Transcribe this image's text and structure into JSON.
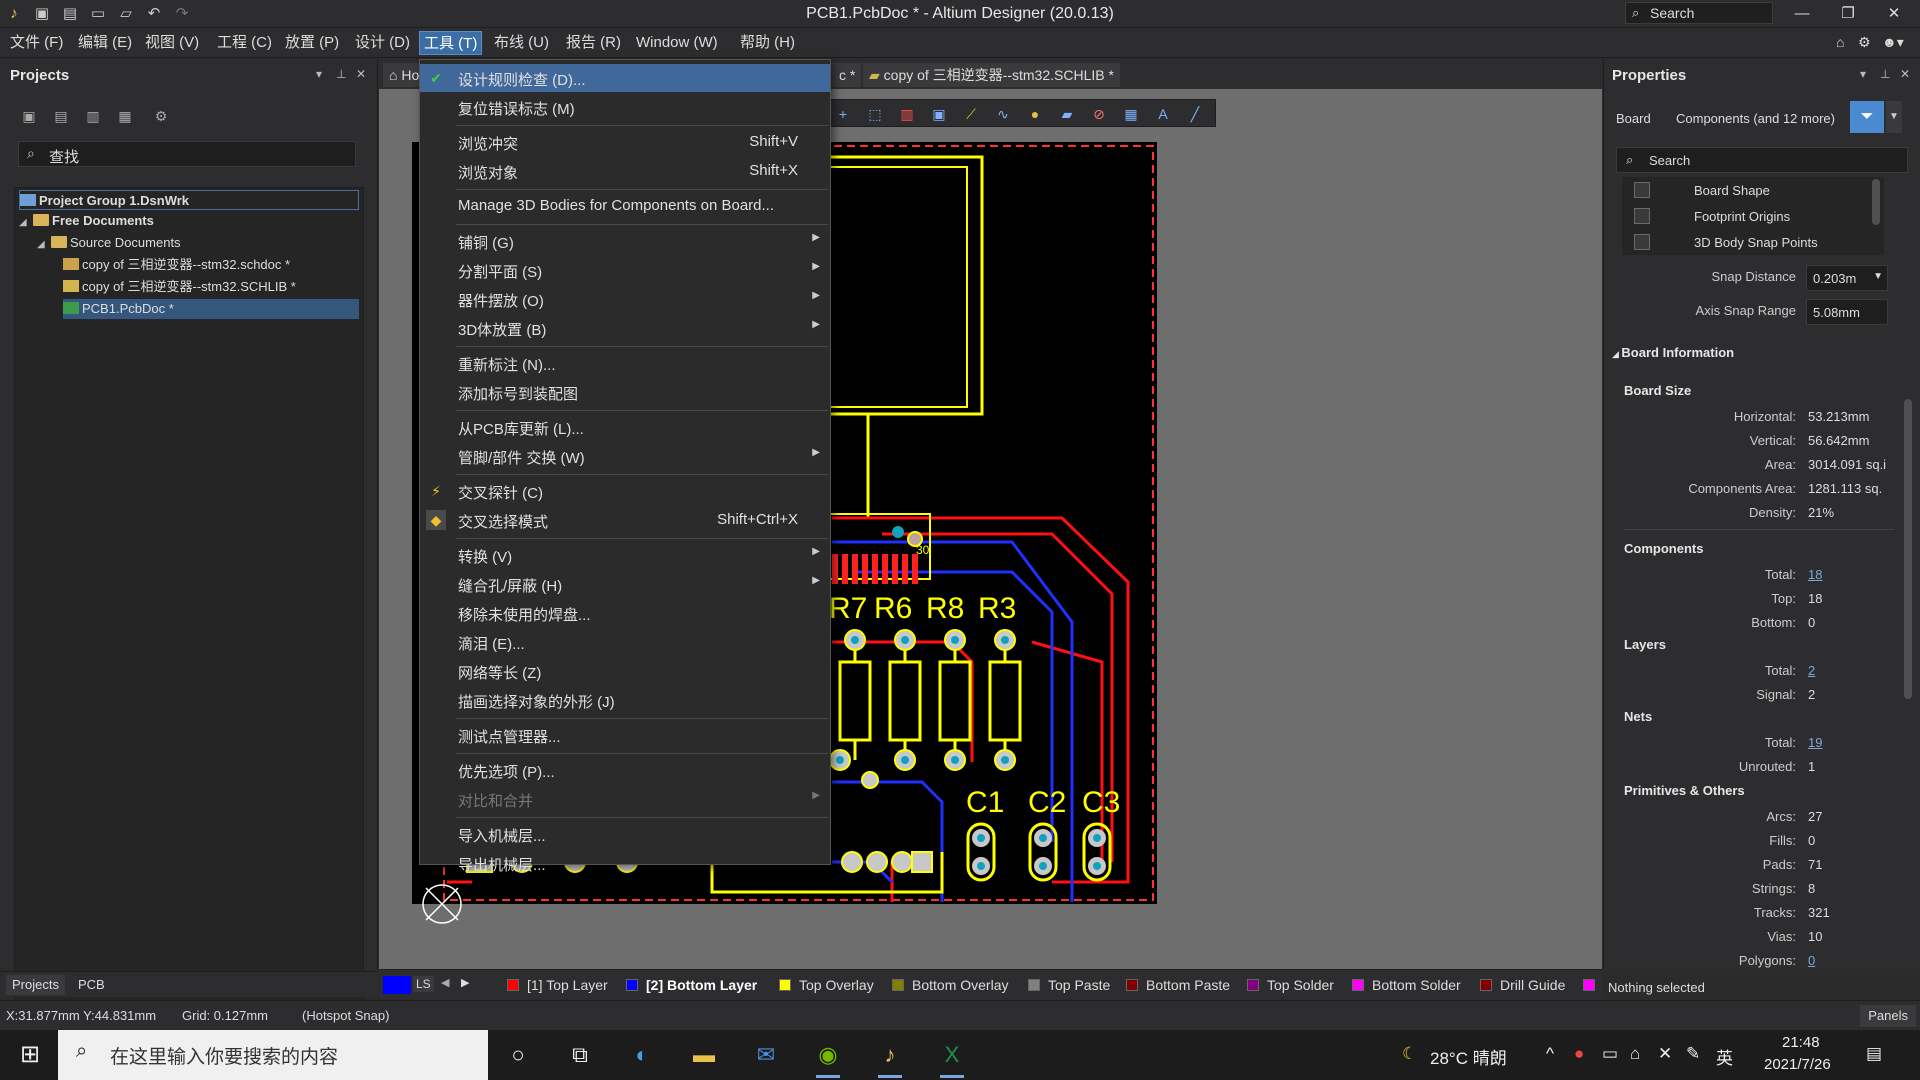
{
  "window": {
    "title": "PCB1.PcbDoc * - Altium Designer (20.0.13)",
    "search_placeholder": "Search"
  },
  "menubar": {
    "items": [
      {
        "label": "文件 (F)"
      },
      {
        "label": "编辑 (E)"
      },
      {
        "label": "视图 (V)"
      },
      {
        "label": "工程 (C)"
      },
      {
        "label": "放置 (P)"
      },
      {
        "label": "设计 (D)"
      },
      {
        "label": "工具 (T)"
      },
      {
        "label": "布线 (U)"
      },
      {
        "label": "报告 (R)"
      },
      {
        "label": "Window (W)"
      },
      {
        "label": "帮助 (H)"
      }
    ],
    "active_index": 6
  },
  "projects_panel": {
    "title": "Projects",
    "search_placeholder": "查找",
    "tree": [
      {
        "label": "Project Group 1.DsnWrk",
        "icon": "project-group-icon"
      },
      {
        "label": "Free Documents",
        "icon": "folder-icon"
      },
      {
        "label": "Source Documents",
        "icon": "folder-icon"
      },
      {
        "label": "copy of 三相逆变器--stm32.schdoc *",
        "icon": "schematic-doc-icon"
      },
      {
        "label": "copy of 三相逆变器--stm32.SCHLIB *",
        "icon": "schlib-doc-icon"
      },
      {
        "label": "PCB1.PcbDoc *",
        "icon": "pcb-doc-icon"
      }
    ],
    "bottom_tabs": [
      "Projects",
      "PCB"
    ]
  },
  "doc_tabs": [
    {
      "label": "Ho"
    },
    {
      "label": "c *"
    },
    {
      "label": "copy of 三相逆变器--stm32.SCHLIB *"
    }
  ],
  "tools_menu": {
    "items": [
      {
        "label": "设计规则检查 (D)...",
        "shortcut": "",
        "submenu": false,
        "icon": "drc-icon",
        "highlighted": true
      },
      {
        "label": "复位错误标志 (M)",
        "shortcut": "",
        "submenu": false
      },
      {
        "sep": true
      },
      {
        "label": "浏览冲突",
        "shortcut": "Shift+V",
        "submenu": false
      },
      {
        "label": "浏览对象",
        "shortcut": "Shift+X",
        "submenu": false
      },
      {
        "sep": true
      },
      {
        "label": "Manage 3D Bodies for Components on Board...",
        "shortcut": "",
        "submenu": false
      },
      {
        "sep": true
      },
      {
        "label": "铺铜 (G)",
        "shortcut": "",
        "submenu": true
      },
      {
        "label": "分割平面 (S)",
        "shortcut": "",
        "submenu": true
      },
      {
        "label": "器件摆放 (O)",
        "shortcut": "",
        "submenu": true
      },
      {
        "label": "3D体放置 (B)",
        "shortcut": "",
        "submenu": true
      },
      {
        "sep": true
      },
      {
        "label": "重新标注 (N)...",
        "shortcut": "",
        "submenu": false
      },
      {
        "label": "添加标号到装配图",
        "shortcut": "",
        "submenu": false
      },
      {
        "sep": true
      },
      {
        "label": "从PCB库更新 (L)...",
        "shortcut": "",
        "submenu": false
      },
      {
        "label": "管脚/部件 交换 (W)",
        "shortcut": "",
        "submenu": true
      },
      {
        "sep": true
      },
      {
        "label": "交叉探针 (C)",
        "shortcut": "",
        "submenu": false,
        "icon": "cross-probe-icon"
      },
      {
        "label": "交叉选择模式",
        "shortcut": "Shift+Ctrl+X",
        "submenu": false,
        "icon": "cross-select-icon"
      },
      {
        "sep": true
      },
      {
        "label": "转换 (V)",
        "shortcut": "",
        "submenu": true
      },
      {
        "label": "缝合孔/屏蔽 (H)",
        "shortcut": "",
        "submenu": true
      },
      {
        "label": "移除未使用的焊盘...",
        "shortcut": "",
        "submenu": false
      },
      {
        "label": "滴泪 (E)...",
        "shortcut": "",
        "submenu": false
      },
      {
        "label": "网络等长 (Z)",
        "shortcut": "",
        "submenu": false
      },
      {
        "label": "描画选择对象的外形 (J)",
        "shortcut": "",
        "submenu": false
      },
      {
        "sep": true
      },
      {
        "label": "测试点管理器...",
        "shortcut": "",
        "submenu": false
      },
      {
        "sep": true
      },
      {
        "label": "优先选项 (P)...",
        "shortcut": "",
        "submenu": false
      },
      {
        "label": "对比和合并",
        "shortcut": "",
        "submenu": true,
        "disabled": true
      },
      {
        "sep": true
      },
      {
        "label": "导入机械层...",
        "shortcut": "",
        "submenu": false
      },
      {
        "label": "导出机械层...",
        "shortcut": "",
        "submenu": false
      }
    ]
  },
  "board_labels": [
    "R7",
    "R6",
    "R8",
    "R3",
    "C1",
    "C2",
    "C3",
    "30"
  ],
  "layer_bar": {
    "ls_label": "LS",
    "layers": [
      {
        "label": "[1] Top Layer",
        "color": "#ff0000"
      },
      {
        "label": "[2] Bottom Layer",
        "color": "#0000ff",
        "active": true
      },
      {
        "label": "Top Overlay",
        "color": "#ffff00"
      },
      {
        "label": "Bottom Overlay",
        "color": "#808000"
      },
      {
        "label": "Top Paste",
        "color": "#808080"
      },
      {
        "label": "Bottom Paste",
        "color": "#800000"
      },
      {
        "label": "Top Solder",
        "color": "#800080"
      },
      {
        "label": "Bottom Solder",
        "color": "#ff00ff"
      },
      {
        "label": "Drill Guide",
        "color": "#800000"
      }
    ]
  },
  "statusbar": {
    "coords": "X:31.877mm Y:44.831mm",
    "grid": "Grid: 0.127mm",
    "snap": "(Hotspot Snap)",
    "selection": "Nothing selected",
    "panels_label": "Panels"
  },
  "properties": {
    "title": "Properties",
    "scope_board": "Board",
    "scope_components": "Components (and 12 more)",
    "search_placeholder": "Search",
    "snap_options": [
      "Board Shape",
      "Footprint Origins",
      "3D Body Snap Points"
    ],
    "snap_distance_label": "Snap Distance",
    "snap_distance_value": "0.203m",
    "axis_snap_label": "Axis Snap Range",
    "axis_snap_value": "5.08mm",
    "board_info_title": "Board Information",
    "board_size_title": "Board Size",
    "board_size": [
      {
        "label": "Horizontal:",
        "value": "53.213mm"
      },
      {
        "label": "Vertical:",
        "value": "56.642mm"
      },
      {
        "label": "Area:",
        "value": "3014.091 sq.i"
      },
      {
        "label": "Components Area:",
        "value": "1281.113 sq."
      },
      {
        "label": "Density:",
        "value": "21%"
      }
    ],
    "components_title": "Components",
    "components": [
      {
        "label": "Total:",
        "value": "18",
        "link": true
      },
      {
        "label": "Top:",
        "value": "18"
      },
      {
        "label": "Bottom:",
        "value": "0"
      }
    ],
    "layers_title": "Layers",
    "layers": [
      {
        "label": "Total:",
        "value": "2",
        "link": true
      },
      {
        "label": "Signal:",
        "value": "2"
      }
    ],
    "nets_title": "Nets",
    "nets": [
      {
        "label": "Total:",
        "value": "19",
        "link": true
      },
      {
        "label": "Unrouted:",
        "value": "1"
      }
    ],
    "primitives_title": "Primitives & Others",
    "primitives": [
      {
        "label": "Arcs:",
        "value": "27"
      },
      {
        "label": "Fills:",
        "value": "0"
      },
      {
        "label": "Pads:",
        "value": "71"
      },
      {
        "label": "Strings:",
        "value": "8"
      },
      {
        "label": "Tracks:",
        "value": "321"
      },
      {
        "label": "Vias:",
        "value": "10"
      },
      {
        "label": "Polygons:",
        "value": "0",
        "link": true
      }
    ]
  },
  "taskbar": {
    "search_placeholder": "在这里输入你要搜索的内容",
    "weather": "28°C 晴朗",
    "ime": "英",
    "time": "21:48",
    "date": "2021/7/26"
  }
}
